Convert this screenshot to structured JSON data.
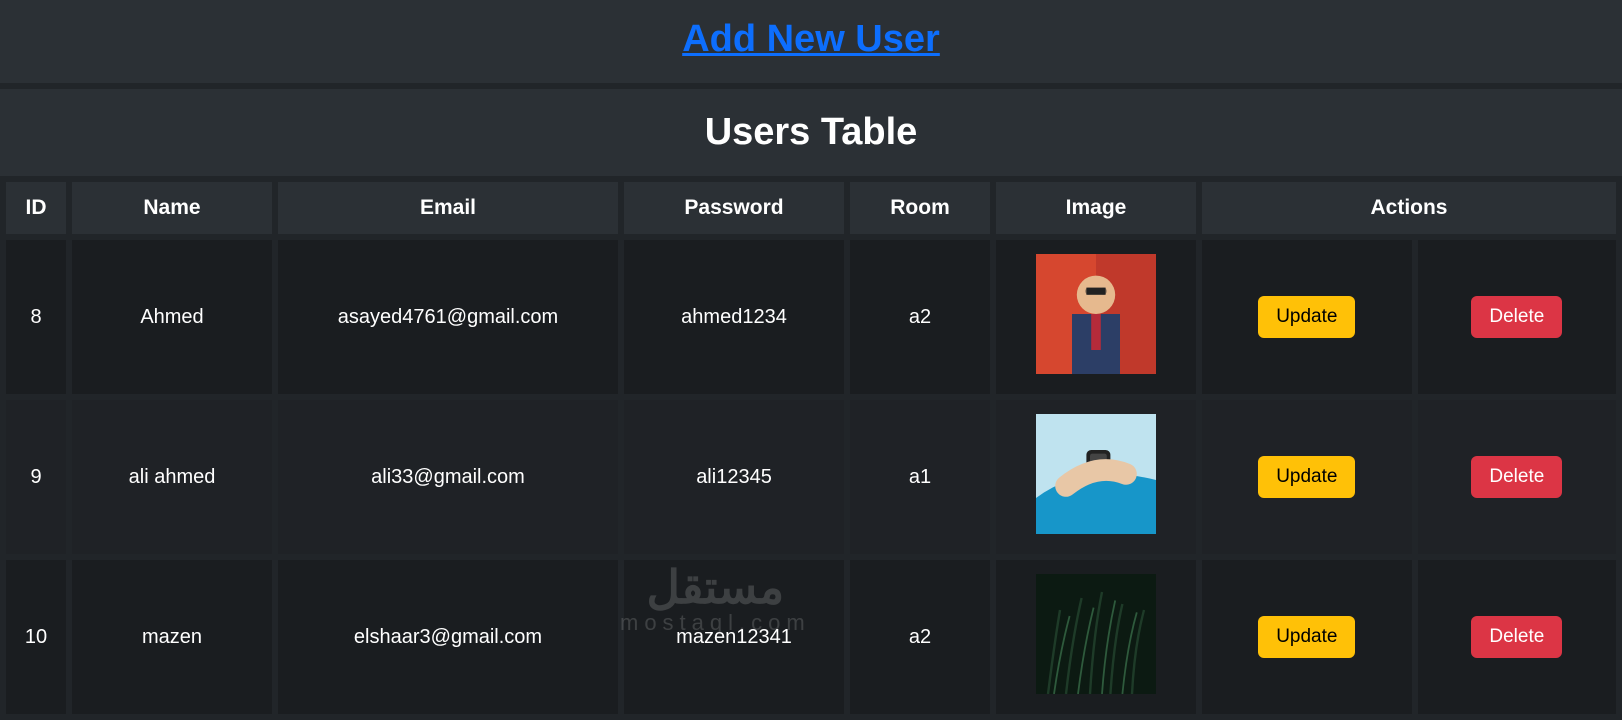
{
  "header": {
    "add_link": "Add New User",
    "title": "Users Table"
  },
  "table": {
    "columns": [
      "ID",
      "Name",
      "Email",
      "Password",
      "Room",
      "Image",
      "Actions"
    ],
    "actions": {
      "update": "Update",
      "delete": "Delete"
    },
    "rows": [
      {
        "id": "8",
        "name": "Ahmed",
        "email": "asayed4761@gmail.com",
        "password": "ahmed1234",
        "room": "a2",
        "image_kind": "person"
      },
      {
        "id": "9",
        "name": "ali ahmed",
        "email": "ali33@gmail.com",
        "password": "ali12345",
        "room": "a1",
        "image_kind": "watch"
      },
      {
        "id": "10",
        "name": "mazen",
        "email": "elshaar3@gmail.com",
        "password": "mazen12341",
        "room": "a2",
        "image_kind": "plants"
      }
    ]
  },
  "watermark": {
    "arabic": "مستقل",
    "latin": "mostaql.com"
  }
}
